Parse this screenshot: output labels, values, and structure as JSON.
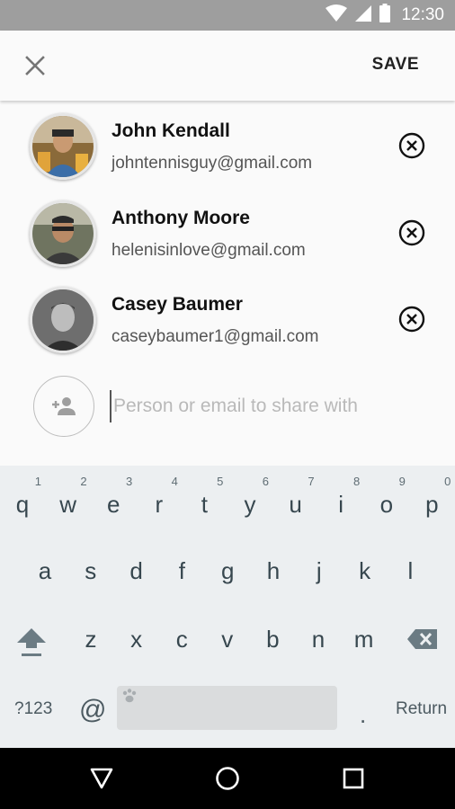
{
  "status_bar": {
    "time": "12:30",
    "icons": [
      "wifi-icon",
      "signal-icon",
      "battery-icon"
    ]
  },
  "app_bar": {
    "close_icon": "close-icon",
    "save_label": "SAVE"
  },
  "contacts": [
    {
      "name": "John Kendall",
      "email": "johntennisguy@gmail.com"
    },
    {
      "name": "Anthony Moore",
      "email": "helenisinlove@gmail.com"
    },
    {
      "name": "Casey Baumer",
      "email": "caseybaumer1@gmail.com"
    }
  ],
  "share": {
    "placeholder": "Person or email to share with",
    "value": ""
  },
  "keyboard": {
    "row1": [
      {
        "key": "q",
        "hint": "1"
      },
      {
        "key": "w",
        "hint": "2"
      },
      {
        "key": "e",
        "hint": "3"
      },
      {
        "key": "r",
        "hint": "4"
      },
      {
        "key": "t",
        "hint": "5"
      },
      {
        "key": "y",
        "hint": "6"
      },
      {
        "key": "u",
        "hint": "7"
      },
      {
        "key": "i",
        "hint": "8"
      },
      {
        "key": "o",
        "hint": "9"
      },
      {
        "key": "p",
        "hint": "0"
      }
    ],
    "row2": [
      "a",
      "s",
      "d",
      "f",
      "g",
      "h",
      "j",
      "k",
      "l"
    ],
    "row3": [
      "z",
      "x",
      "c",
      "v",
      "b",
      "n",
      "m"
    ],
    "symbols_label": "?123",
    "at_label": "@",
    "period_label": ".",
    "return_label": "Return"
  },
  "nav_bar": {
    "icons": [
      "back-icon",
      "home-icon",
      "recents-icon"
    ]
  },
  "colors": {
    "accent": "#37474f",
    "keyboard_bg": "#eceff1",
    "status_bar": "#9e9e9e"
  }
}
